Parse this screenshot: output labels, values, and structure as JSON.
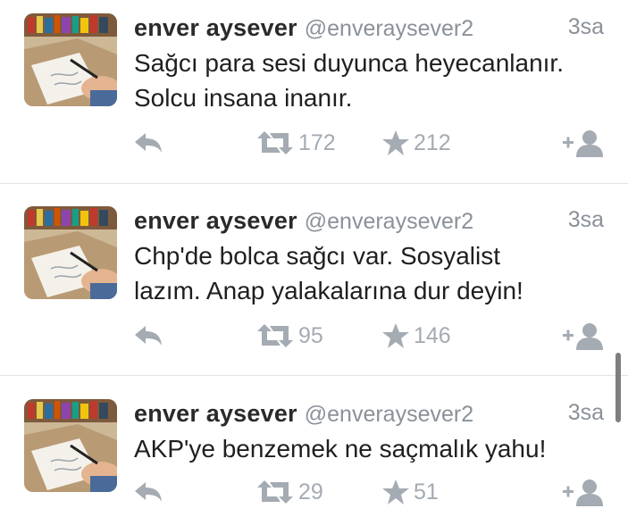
{
  "tweets": [
    {
      "name": "enver aysever",
      "handle": "@enveraysever2",
      "time": "3sa",
      "text": "Sağcı para sesi duyunca heyecanlanır.\nSolcu insana inanır.",
      "retweets": "172",
      "favorites": "212"
    },
    {
      "name": "enver aysever",
      "handle": "@enveraysever2",
      "time": "3sa",
      "text": "Chp'de bolca sağcı var. Sosyalist\nlazım. Anap yalakalarına dur deyin!",
      "retweets": "95",
      "favorites": "146"
    },
    {
      "name": "enver aysever",
      "handle": "@enveraysever2",
      "time": "3sa",
      "text": "AKP'ye benzemek ne saçmalık yahu!",
      "retweets": "29",
      "favorites": "51"
    }
  ],
  "icons": {
    "reply": "reply-icon",
    "retweet": "retweet-icon",
    "favorite": "star-icon",
    "follow": "follow-icon"
  },
  "colors": {
    "name": "#2a2a2a",
    "meta": "#8a9199",
    "action": "#a4abb2",
    "divider": "#dfe3e6"
  }
}
